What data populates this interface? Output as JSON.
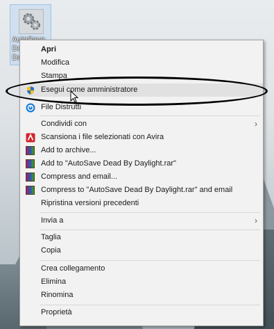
{
  "desktop_icon": {
    "label_lines": [
      "AutoSave",
      "Dead By",
      "Daylight"
    ],
    "icon": "gear-settings-icon"
  },
  "context_menu": {
    "items": [
      {
        "label": "Apri",
        "bold": true
      },
      {
        "label": "Modifica"
      },
      {
        "label": "Stampa"
      },
      {
        "label": "Esegui come amministratore",
        "icon": "uac-shield-icon",
        "highlighted": true
      },
      {
        "label": "File Distrutti",
        "icon": "file-shredder-icon"
      },
      {
        "label": "Condividi con",
        "submenu": true
      },
      {
        "label": "Scansiona i file selezionati con Avira",
        "icon": "avira-icon"
      },
      {
        "label": "Add to archive...",
        "icon": "winrar-icon"
      },
      {
        "label": "Add to \"AutoSave Dead By Daylight.rar\"",
        "icon": "winrar-icon"
      },
      {
        "label": "Compress and email...",
        "icon": "winrar-icon"
      },
      {
        "label": "Compress to \"AutoSave Dead By Daylight.rar\" and email",
        "icon": "winrar-icon"
      },
      {
        "label": "Ripristina versioni precedenti"
      },
      {
        "label": "Invia a",
        "submenu": true
      },
      {
        "label": "Taglia"
      },
      {
        "label": "Copia"
      },
      {
        "label": "Crea collegamento"
      },
      {
        "label": "Elimina"
      },
      {
        "label": "Rinomina"
      },
      {
        "label": "Proprietà"
      }
    ]
  },
  "colors": {
    "menu_bg": "#f2f2f2",
    "highlight": "#e1e1e1",
    "annotation": "#000000",
    "avira": "#d2232a",
    "shredder": "#1f7fd6"
  }
}
